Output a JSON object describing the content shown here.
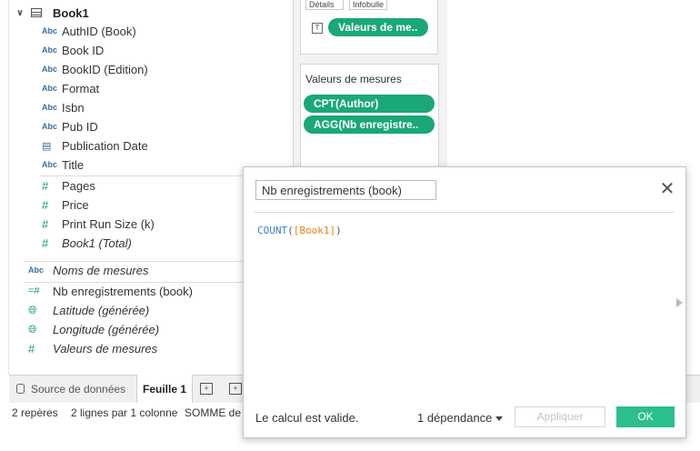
{
  "data_pane": {
    "datasource_label": "Book1",
    "dimensions": [
      {
        "type": "Abc",
        "label": "AuthID (Book)"
      },
      {
        "type": "Abc",
        "label": "Book ID"
      },
      {
        "type": "Abc",
        "label": "BookID (Edition)"
      },
      {
        "type": "Abc",
        "label": "Format"
      },
      {
        "type": "Abc",
        "label": "Isbn"
      },
      {
        "type": "Abc",
        "label": "Pub ID"
      },
      {
        "type": "date",
        "label": "Publication Date"
      },
      {
        "type": "Abc",
        "label": "Title"
      }
    ],
    "measures": [
      {
        "type": "#",
        "label": "Pages"
      },
      {
        "type": "#",
        "label": "Price"
      },
      {
        "type": "#",
        "label": "Print Run Size (k)"
      },
      {
        "type": "#",
        "label": "Book1 (Total)"
      }
    ],
    "extra_fields": [
      {
        "type": "Abc",
        "label": "Noms de mesures"
      },
      {
        "type": "=#",
        "label": "Nb enregistrements (book)"
      },
      {
        "type": "geo",
        "label": "Latitude (générée)"
      },
      {
        "type": "geo",
        "label": "Longitude (générée)"
      },
      {
        "type": "#",
        "label": "Valeurs de mesures"
      }
    ]
  },
  "marks_card": {
    "details_button": "Détails",
    "tooltip_button": "Infobulle",
    "text_icon": "T",
    "text_pill": "Valeurs de me.."
  },
  "measure_values_card": {
    "title": "Valeurs de mesures",
    "pills": [
      "CPT(Author)",
      "AGG(Nb enregistre.."
    ]
  },
  "bottom_tabs": {
    "datasource_tab": "Source de données",
    "sheet_tab": "Feuille 1",
    "new_sheet_icon": "new-worksheet-icon",
    "new_dashboard_icon": "new-dashboard-icon"
  },
  "status_bar": {
    "marks": "2 repères",
    "rows_cols": "2 lignes par 1 colonne",
    "sum": "SOMME de V"
  },
  "calc_dialog": {
    "name_value": "Nb enregistrements (book)",
    "formula_func": "COUNT",
    "formula_open": "(",
    "formula_field": "[Book1]",
    "formula_close": ")",
    "status_message": "Le calcul est valide.",
    "dependencies": "1 dépendance",
    "apply_label": "Appliquer",
    "ok_label": "OK"
  },
  "colors": {
    "pill_green": "#1aa779",
    "ok_green": "#2bbf8c",
    "formula_blue": "#3a7fbd",
    "field_orange": "#e8821a"
  }
}
